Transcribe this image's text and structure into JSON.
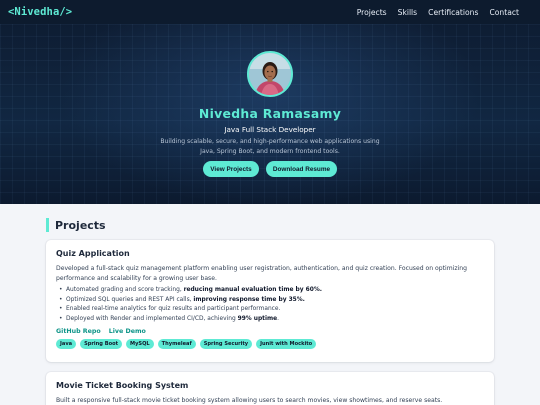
{
  "nav": {
    "logo": "<Nivedha/>",
    "links": [
      "Projects",
      "Skills",
      "Certifications",
      "Contact"
    ]
  },
  "hero": {
    "name": "Nivedha Ramasamy",
    "role": "Java Full Stack Developer",
    "description": "Building scalable, secure, and high-performance web applications using Java, Spring Boot, and modern frontend tools.",
    "buttons": {
      "projects": "View Projects",
      "resume": "Download Resume"
    }
  },
  "projects": {
    "title": "Projects",
    "items": [
      {
        "title": "Quiz Application",
        "description": "Developed a full-stack quiz management platform enabling user registration, authentication, and quiz creation. Focused on optimizing performance and scalability for a growing user base.",
        "bullets": [
          {
            "text": "Automated grading and score tracking, ",
            "bold": "reducing manual evaluation time by 60%.",
            "after": ""
          },
          {
            "text": "Optimized SQL queries and REST API calls, ",
            "bold": "improving response time by 35%.",
            "after": ""
          },
          {
            "text": "Enabled real-time analytics for quiz results and participant performance.",
            "bold": "",
            "after": ""
          },
          {
            "text": "Deployed with Render and implemented CI/CD, achieving ",
            "bold": "99% uptime",
            "after": "."
          }
        ],
        "links": [
          "GitHub Repo",
          "Live Demo"
        ],
        "tags": [
          "Java",
          "Spring Boot",
          "MySQL",
          "Thymeleaf",
          "Spring Security",
          "Junit with Mockito"
        ]
      },
      {
        "title": "Movie Ticket Booking System",
        "description": "Built a responsive full-stack movie ticket booking system allowing users to search movies, view showtimes, and reserve seats."
      }
    ]
  },
  "colors": {
    "accent": "#5eead4",
    "navbar": "#0d1b2e",
    "hero_bg": "#112742",
    "page_bg": "#f3f5f9",
    "link": "#0d9488"
  },
  "icons": {
    "avatar": "profile-photo"
  }
}
